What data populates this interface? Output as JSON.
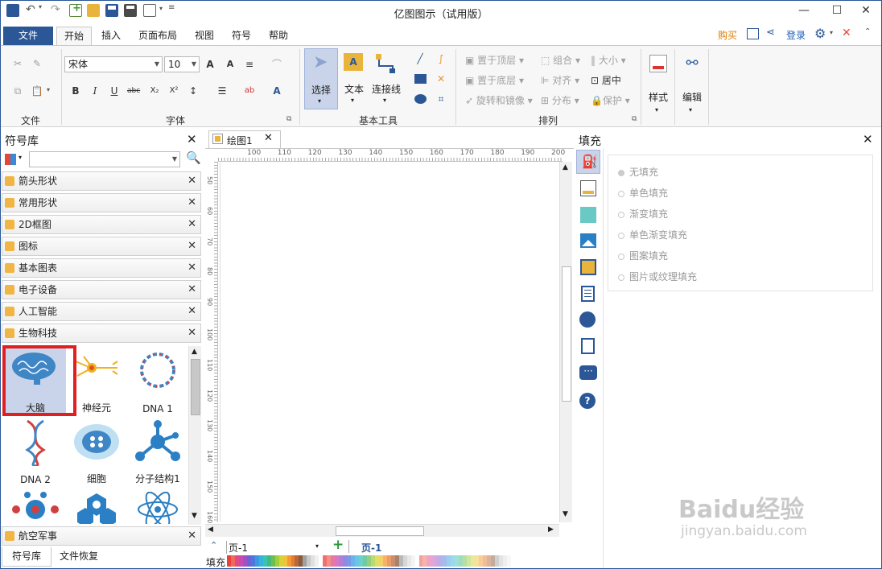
{
  "app": {
    "title": "亿图图示（试用版）"
  },
  "titlebar": {
    "minimize": "—",
    "maximize": "☐",
    "close": "✕"
  },
  "menu": {
    "file": "文件",
    "tabs": [
      "开始",
      "插入",
      "页面布局",
      "视图",
      "符号",
      "帮助"
    ],
    "buy": "购买",
    "login": "登录"
  },
  "ribbon": {
    "groups": {
      "file": "文件",
      "font": "字体",
      "basic_tools": "基本工具",
      "arrange": "排列"
    },
    "font_name": "宋体",
    "font_size": "10",
    "select_label": "选择",
    "text_label": "文本",
    "connector_label": "连接线",
    "arrange": {
      "bring_front": "置于顶层",
      "send_back": "置于底层",
      "rotate_mirror": "旋转和镜像",
      "group": "组合",
      "align": "对齐",
      "distribute": "分布",
      "size": "大小",
      "center": "居中",
      "protect": "保护"
    },
    "style_label": "样式",
    "edit_label": "编辑"
  },
  "left": {
    "title": "符号库",
    "libraries": [
      "箭头形状",
      "常用形状",
      "2D框图",
      "图标",
      "基本图表",
      "电子设备",
      "人工智能",
      "生物科技"
    ],
    "symbols": [
      "大脑",
      "神经元",
      "DNA 1",
      "DNA 2",
      "细胞",
      "分子结构1"
    ],
    "bottom_library": "航空军事",
    "bottom_tabs": [
      "符号库",
      "文件恢复"
    ]
  },
  "canvas": {
    "tab": "绘图1",
    "hticks": [
      "100",
      "110",
      "120",
      "130",
      "140",
      "150",
      "160",
      "170",
      "180",
      "190",
      "200"
    ],
    "vticks": [
      "50",
      "60",
      "70",
      "80",
      "90",
      "100",
      "110",
      "120",
      "130",
      "140",
      "150",
      "160"
    ],
    "page_select": "页-1",
    "page_tab": "页-1",
    "fill_label": "填充"
  },
  "right": {
    "title": "填充",
    "options": [
      "无填充",
      "单色填充",
      "渐变填充",
      "单色渐变填充",
      "图案填充",
      "图片或纹理填充"
    ]
  },
  "colors": {
    "accent": "#2b5797",
    "highlight": "#e02020",
    "selected_bg": "#c9d4ea",
    "buy": "#e07b00",
    "link": "#1f5fbf"
  },
  "watermark": {
    "line1": "Baidu经验",
    "line2": "jingyan.baidu.com"
  }
}
